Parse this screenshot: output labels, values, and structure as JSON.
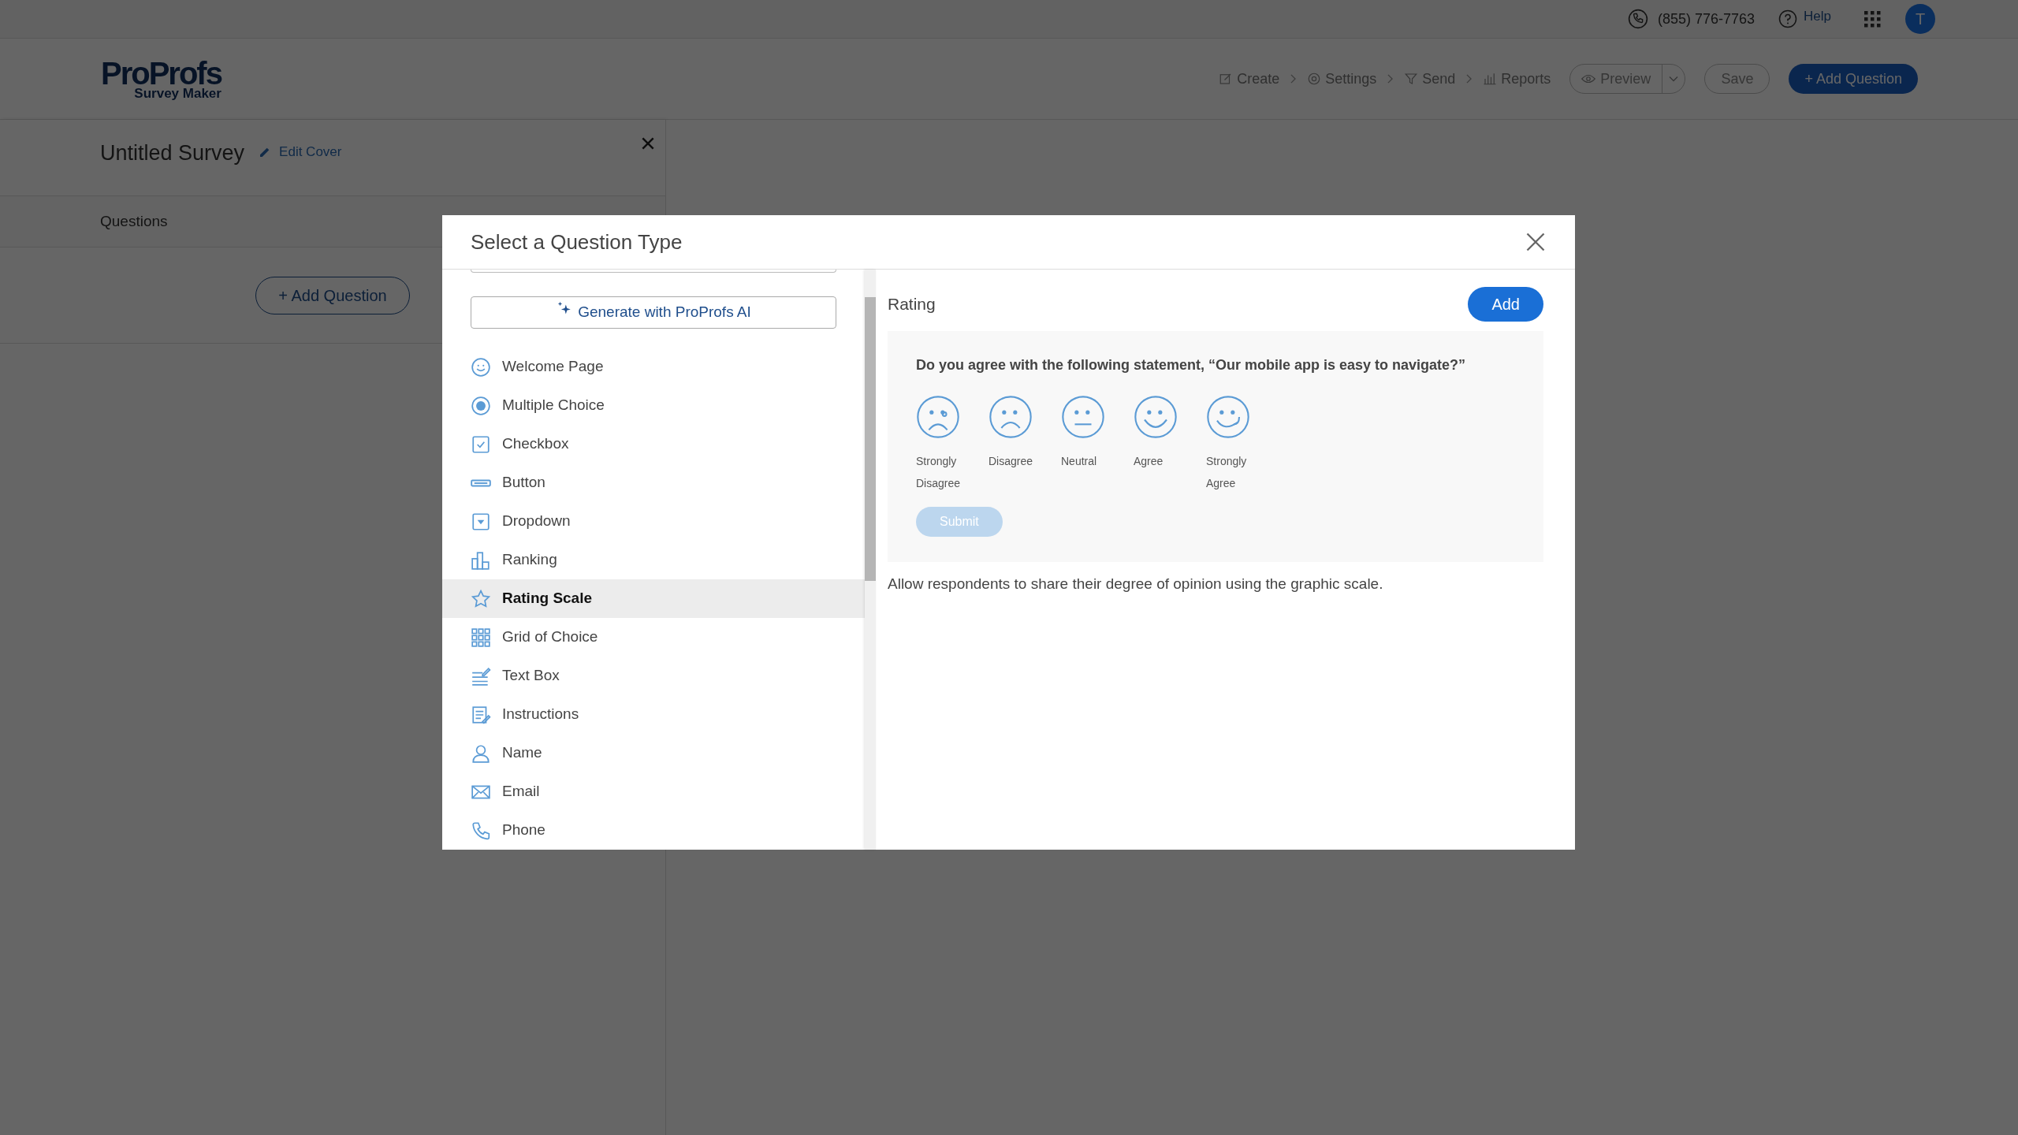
{
  "topbar": {
    "phone": "(855) 776-7763",
    "help": "Help",
    "avatar": "T"
  },
  "header": {
    "logo_main": "ProProfs",
    "logo_sub": "Survey Maker",
    "steps": [
      {
        "label": "Create",
        "kind": "create"
      },
      {
        "label": "Settings",
        "kind": "settings"
      },
      {
        "label": "Send",
        "kind": "send"
      },
      {
        "label": "Reports",
        "kind": "reports"
      }
    ],
    "preview": "Preview",
    "save": "Save",
    "add_question": "+ Add Question"
  },
  "survey": {
    "title": "Untitled Survey",
    "edit_cover": "Edit Cover",
    "questions_label": "Questions",
    "add_question": "+ Add Question"
  },
  "modal": {
    "title": "Select a Question Type",
    "generate": "Generate with ProProfs AI",
    "types": [
      {
        "label": "Welcome Page",
        "kind": "smile",
        "selected": false
      },
      {
        "label": "Multiple Choice",
        "kind": "radio",
        "selected": false
      },
      {
        "label": "Checkbox",
        "kind": "checkbox",
        "selected": false
      },
      {
        "label": "Button",
        "kind": "button",
        "selected": false
      },
      {
        "label": "Dropdown",
        "kind": "dropdown",
        "selected": false
      },
      {
        "label": "Ranking",
        "kind": "ranking",
        "selected": false
      },
      {
        "label": "Rating Scale",
        "kind": "star",
        "selected": true
      },
      {
        "label": "Grid of Choice",
        "kind": "grid",
        "selected": false
      },
      {
        "label": "Text Box",
        "kind": "textbox",
        "selected": false
      },
      {
        "label": "Instructions",
        "kind": "instructions",
        "selected": false
      },
      {
        "label": "Name",
        "kind": "person",
        "selected": false
      },
      {
        "label": "Email",
        "kind": "mail",
        "selected": false
      },
      {
        "label": "Phone",
        "kind": "phone",
        "selected": false
      }
    ],
    "preview_title": "Rating",
    "add": "Add",
    "question": "Do you agree with the following statement, “Our mobile app is easy to navigate?”",
    "faces": [
      {
        "label": "Strongly Disagree",
        "kind": "crying"
      },
      {
        "label": "Disagree",
        "kind": "sad"
      },
      {
        "label": "Neutral",
        "kind": "neutral"
      },
      {
        "label": "Agree",
        "kind": "happy"
      },
      {
        "label": "Strongly Agree",
        "kind": "tongue"
      }
    ],
    "submit": "Submit",
    "description": "Allow respondents to share their degree of opinion using the graphic scale."
  }
}
